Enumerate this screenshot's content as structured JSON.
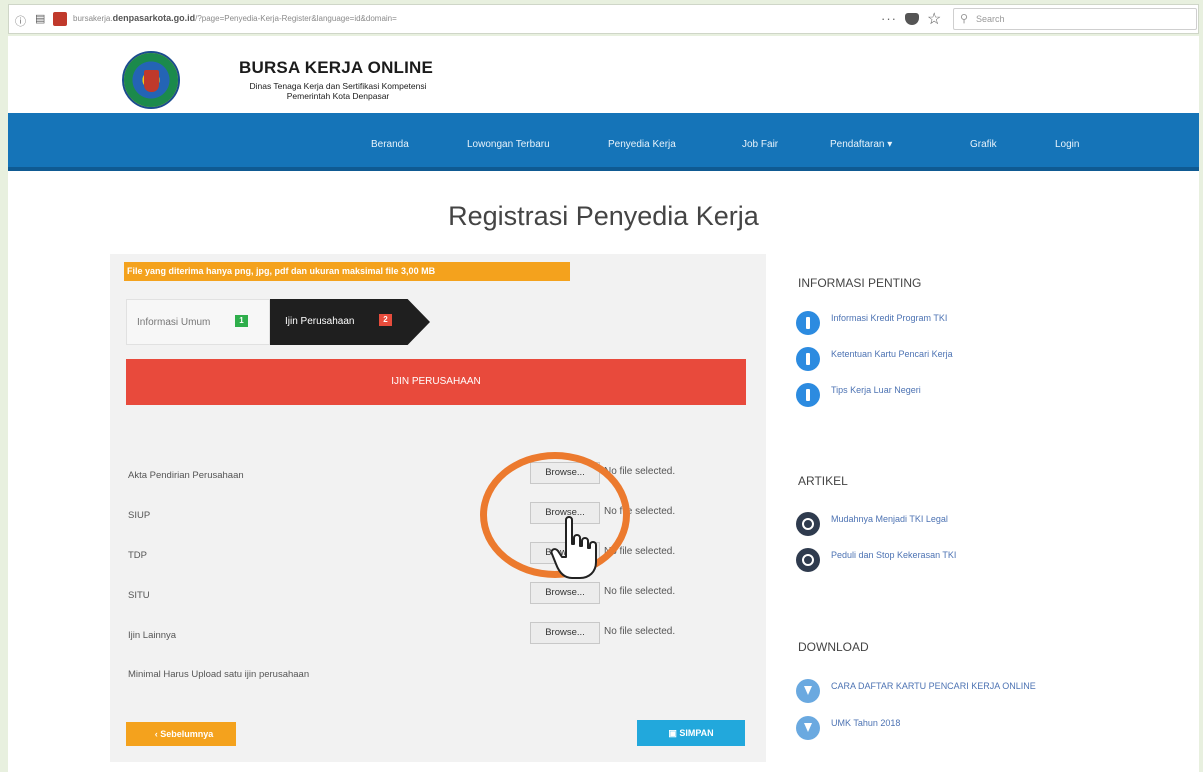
{
  "browser": {
    "url_host": "denpasarkota.go.id",
    "url_prefix": "bursakerja.",
    "url_path": "/?page=Penyedia-Kerja-Register&language=id&domain=",
    "search_placeholder": "Search"
  },
  "header": {
    "title": "BURSA KERJA ONLINE",
    "subtitle_line1": "Dinas Tenaga Kerja dan Sertifikasi Kompetensi",
    "subtitle_line2": "Pemerintah Kota Denpasar"
  },
  "nav": {
    "items": [
      "Beranda",
      "Lowongan Terbaru",
      "Penyedia Kerja",
      "Job Fair",
      "Pendaftaran ▾",
      "Grafik",
      "Login"
    ]
  },
  "page": {
    "title": "Registrasi Penyedia Kerja"
  },
  "form": {
    "notice": "File yang diterima hanya png, jpg, pdf dan ukuran maksimal file 3,00 MB",
    "tabs": [
      {
        "label": "Informasi Umum",
        "badge": "1"
      },
      {
        "label": "Ijin Perusahaan",
        "badge": "2"
      }
    ],
    "section_title": "IJIN PERUSAHAAN",
    "browse_label": "Browse...",
    "no_file_text": "No file selected.",
    "rows": [
      {
        "label": "Akta Pendirian Perusahaan"
      },
      {
        "label": "SIUP"
      },
      {
        "label": "TDP"
      },
      {
        "label": "SITU"
      },
      {
        "label": "Ijin Lainnya"
      }
    ],
    "min_note": "Minimal Harus Upload satu ijin perusahaan",
    "prev_button": "‹ Sebelumnya",
    "save_button": "▣ SIMPAN"
  },
  "sidebar": {
    "info_title": "INFORMASI PENTING",
    "info_items": [
      "Informasi Kredit Program TKI",
      "Ketentuan Kartu Pencari Kerja",
      "Tips Kerja Luar Negeri"
    ],
    "article_title": "ARTIKEL",
    "article_items": [
      "Mudahnya Menjadi TKI Legal",
      "Peduli dan Stop Kekerasan TKI"
    ],
    "download_title": "DOWNLOAD",
    "download_items": [
      "CARA DAFTAR KARTU PENCARI KERJA ONLINE",
      "UMK Tahun 2018"
    ]
  },
  "colors": {
    "nav_blue": "#1574b8",
    "section_red": "#e84a3c",
    "notice_orange": "#f4a21d",
    "save_blue": "#22a8dc",
    "highlight_orange": "#ec7a2e"
  }
}
